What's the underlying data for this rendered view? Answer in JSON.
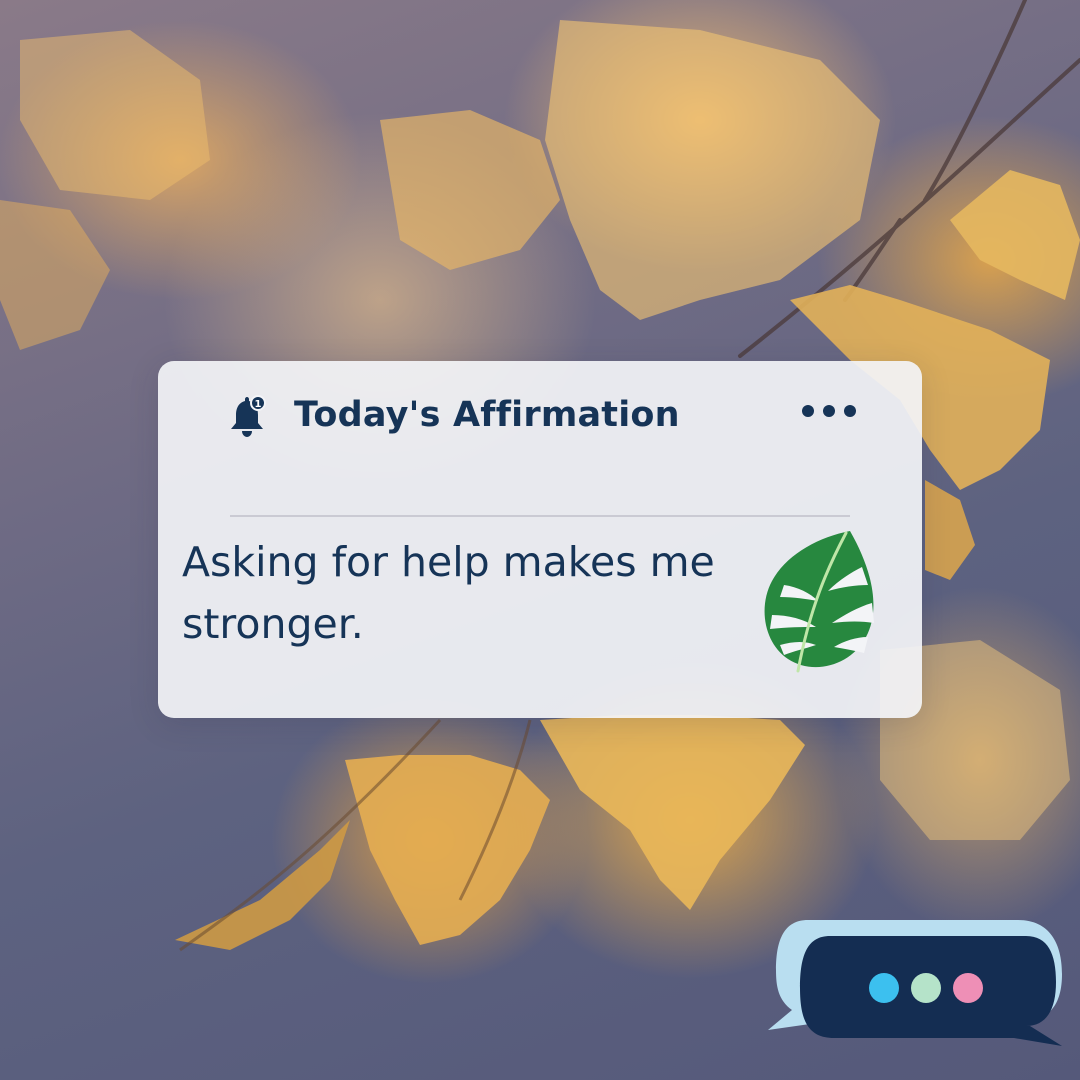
{
  "notification": {
    "title": "Today's Affirmation",
    "message": "Asking for help makes me stronger.",
    "bell_badge": "1",
    "icons": {
      "bell": "bell-notification-icon",
      "more": "more-horizontal-icon",
      "leaf": "monstera-leaf-icon"
    }
  },
  "chat_bubble": {
    "icon": "chat-typing-bubble-icon",
    "dot_colors": [
      "#3cc0ef",
      "#b5e3c9",
      "#ee8fb6"
    ]
  },
  "colors": {
    "text": "#163457",
    "card": "#f3f4f7",
    "leaf": "#27883f",
    "bubble_dark": "#142d52",
    "bubble_light": "#b9def0"
  }
}
